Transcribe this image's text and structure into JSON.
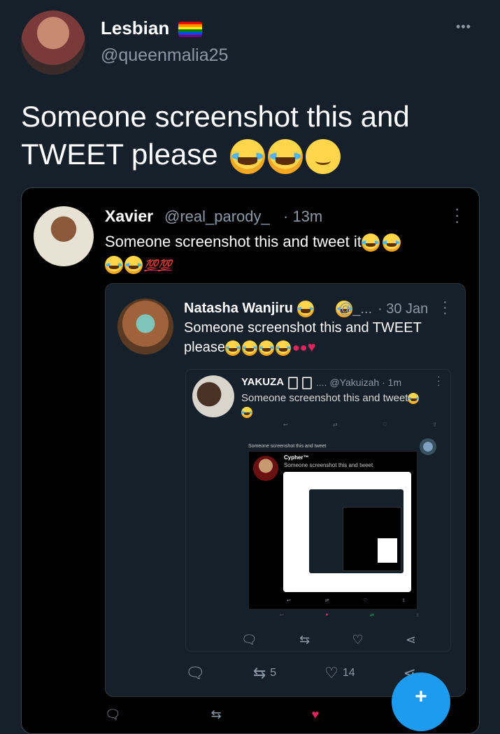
{
  "main_tweet": {
    "display_name": "Lesbian",
    "handle": "@queenmalia25",
    "text": "Someone screenshot this and TWEET please",
    "more_label": "•••"
  },
  "quote1": {
    "display_name": "Xavier",
    "handle": "@real_parody_",
    "time": "· 13m",
    "text": "Someone screenshot this and tweet it",
    "hundred": "💯💯"
  },
  "quote2": {
    "display_name": "Natasha Wanjiru",
    "handle": "@_...",
    "time": "· 30 Jan",
    "text_line1": "Someone screenshot this and TWEET",
    "text_line2": "please",
    "retweets": "5",
    "likes": "14"
  },
  "quote3": {
    "display_name": "YAKUZA",
    "handle": ".... @Yakuizah · 1m",
    "text": "Someone screenshot this and tweet"
  },
  "deep": {
    "caption": "Someone screenshot this and tweet",
    "name4": "Cypher™",
    "text4": "Someone screenshot this and tweet"
  },
  "colors": {
    "background": "#15202b",
    "frame": "#000000",
    "muted": "#8b98a5",
    "accent": "#1d9bf0",
    "heart": "#e0245e"
  }
}
